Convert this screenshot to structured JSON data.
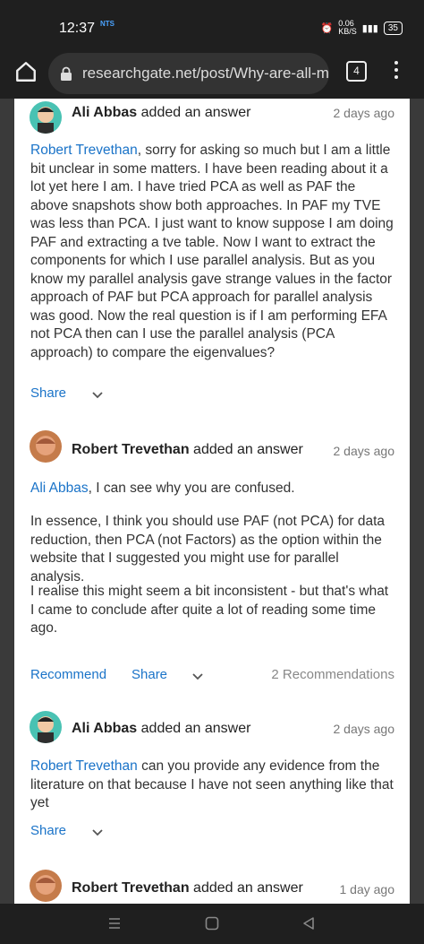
{
  "status": {
    "time": "12:37",
    "carrier": "NTS",
    "speed": "0.06\nKB/S",
    "battery": "35"
  },
  "browser": {
    "url": "researchgate.net/post/Why-are-all-m",
    "tab_count": "4"
  },
  "posts": [
    {
      "author": "Ali Abbas",
      "action": "added an answer",
      "date": "2 days ago",
      "mention": "Robert Trevethan",
      "text": ", sorry for asking so much but I am a little bit unclear in some matters. I have been reading about it a lot yet here I am. I have tried PCA as well as PAF the above snapshots show both approaches. In PAF my TVE was less than PCA. I just want to know suppose I am doing PAF and extracting a tve table. Now I want to extract the components for which I use parallel analysis. But as you know my parallel analysis gave strange values in the factor approach of PAF but PCA approach for parallel analysis was good. Now the real question is if I am performing EFA not PCA then can I use the parallel analysis (PCA approach) to compare the eigenvalues?",
      "share": "Share"
    },
    {
      "author": "Robert Trevethan",
      "action": "added an answer",
      "date": "2 days ago",
      "mention": "Ali Abbas",
      "p1": ", I can see why you are confused.",
      "p2": "In essence, I think you should use PAF (not PCA) for data reduction, then PCA (not Factors) as the option within the website that I suggested you might use for parallel analysis.",
      "p3": "I realise this might seem a bit inconsistent - but that's what I came to conclude after quite a lot of reading some time ago.",
      "recommend": "Recommend",
      "share": "Share",
      "recommendations": "2 Recommendations"
    },
    {
      "author": "Ali Abbas",
      "action": "added an answer",
      "date": "2 days ago",
      "mention": "Robert Trevethan",
      "text": " can you provide any evidence from the literature on that because I have not seen anything like that yet",
      "share": "Share"
    },
    {
      "author": "Robert Trevethan",
      "action": "added an answer",
      "date": "1 day ago"
    }
  ]
}
